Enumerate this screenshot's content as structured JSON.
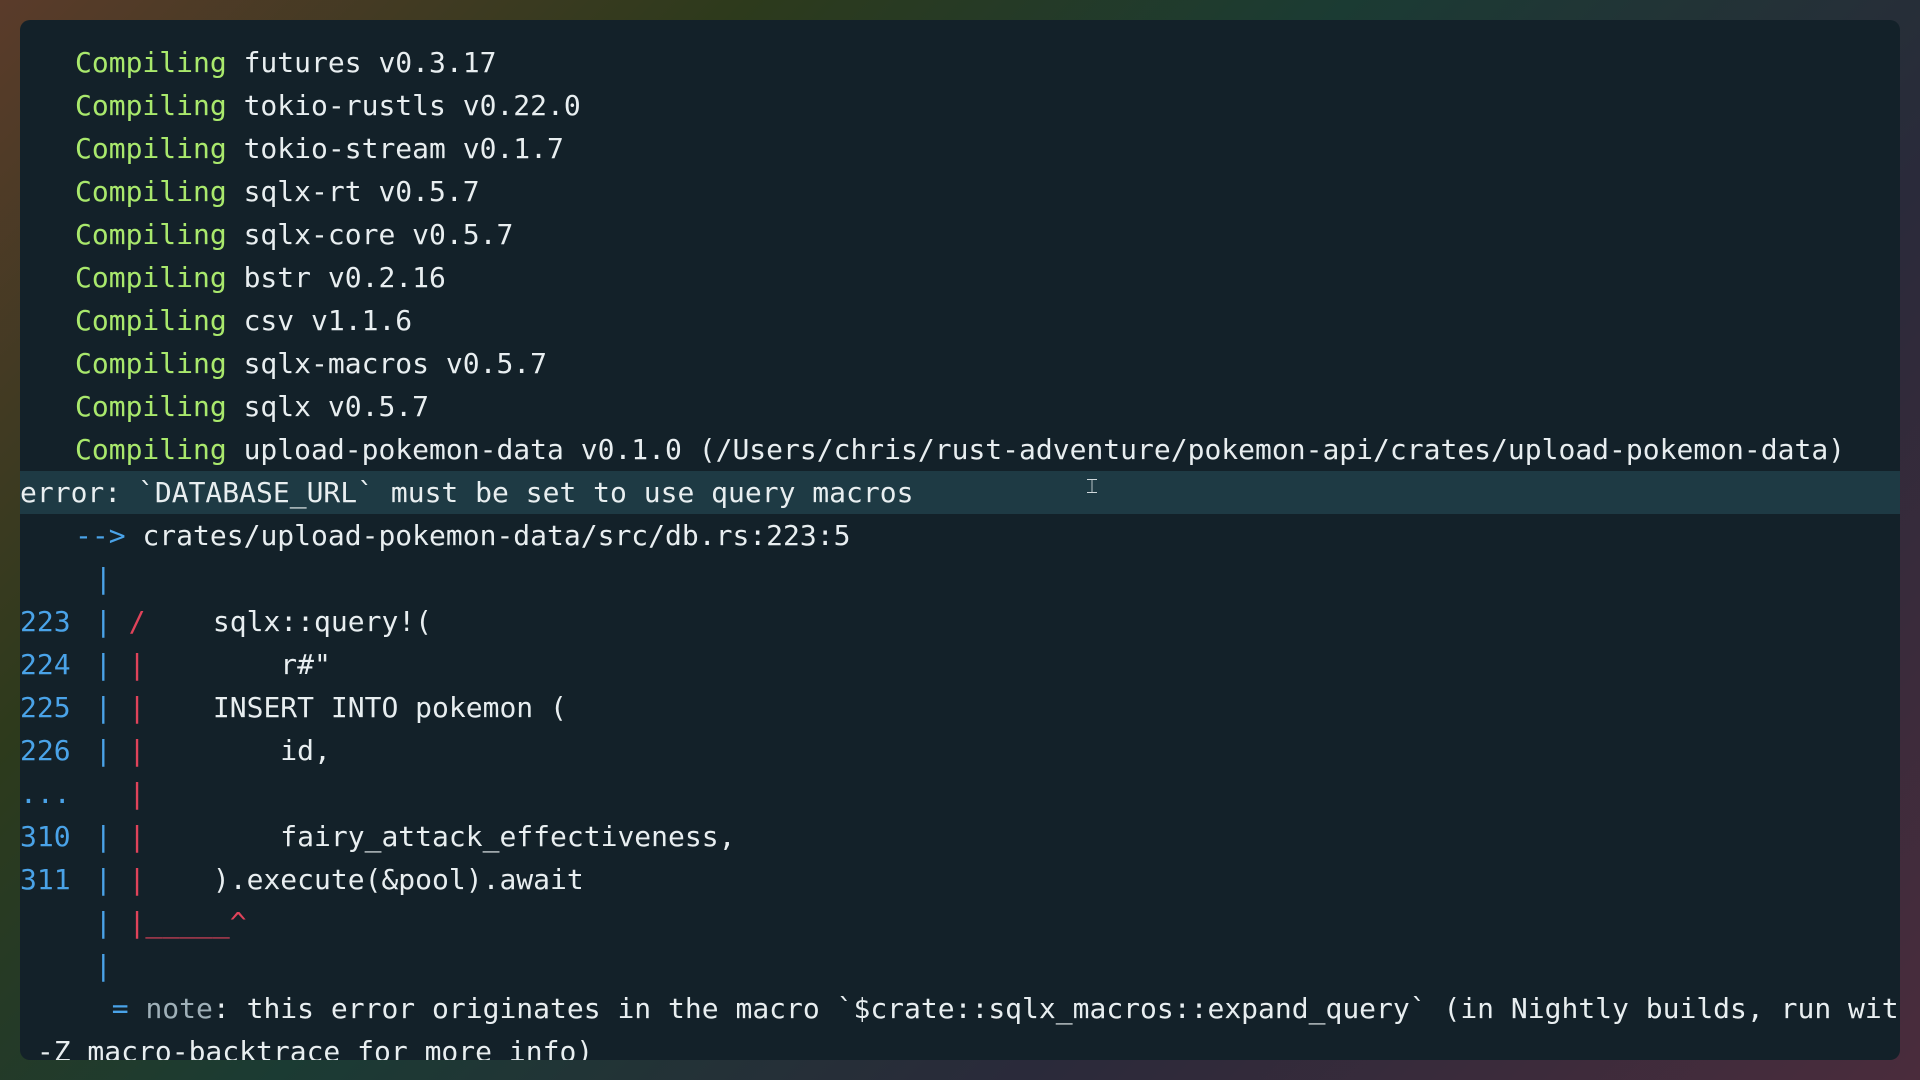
{
  "compiling_keyword": "Compiling",
  "compile_lines": [
    "futures v0.3.17",
    "tokio-rustls v0.22.0",
    "tokio-stream v0.1.7",
    "sqlx-rt v0.5.7",
    "sqlx-core v0.5.7",
    "bstr v0.2.16",
    "csv v1.1.6",
    "sqlx-macros v0.5.7",
    "sqlx v0.5.7",
    "upload-pokemon-data v0.1.0 (/Users/chris/rust-adventure/pokemon-api/crates/upload-pokemon-data)"
  ],
  "error": {
    "message": "error: `DATABASE_URL` must be set to use query macros",
    "arrow": "-->",
    "location": "crates/upload-pokemon-data/src/db.rs:223:5"
  },
  "code": [
    {
      "no": "223",
      "marker": "/",
      "text": "    sqlx::query!("
    },
    {
      "no": "224",
      "marker": "|",
      "text": "        r#\""
    },
    {
      "no": "225",
      "marker": "|",
      "text": "    INSERT INTO pokemon ("
    },
    {
      "no": "226",
      "marker": "|",
      "text": "        id,"
    },
    {
      "no": "...",
      "marker": "|",
      "text": ""
    },
    {
      "no": "310",
      "marker": "|",
      "text": "        fairy_attack_effectiveness,"
    },
    {
      "no": "311",
      "marker": "|",
      "text": "    ).execute(&pool).await"
    }
  ],
  "underline": "|_____^",
  "note": {
    "eq": "=",
    "label": "note",
    "text": ": this error originates in the macro `$crate::sqlx_macros::expand_query` (in Nightly builds, run with",
    "continuation": " -Z macro-backtrace for more info)"
  },
  "colors": {
    "compiling": "#a9e86c",
    "line_numbers": "#4aa3e8",
    "error_marker": "#e0435a",
    "background": "#132129"
  },
  "cursor_icon": "text-cursor-icon"
}
